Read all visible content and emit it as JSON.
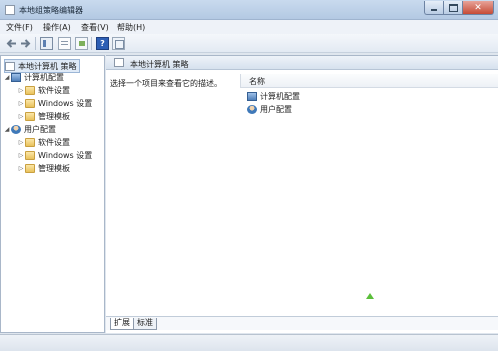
{
  "window": {
    "title": "本地组策略编辑器"
  },
  "menu": [
    "文件(F)",
    "操作(A)",
    "查看(V)",
    "帮助(H)"
  ],
  "toolbar": {
    "buttons": [
      "back-arrow-icon",
      "forward-arrow-icon",
      "show-tree-icon",
      "properties-icon",
      "export-icon",
      "help-icon",
      "view-icon"
    ]
  },
  "tree": {
    "root": "本地计算机 策略",
    "computer": {
      "label": "计算机配置",
      "children": [
        "软件设置",
        "Windows 设置",
        "管理模板"
      ]
    },
    "user": {
      "label": "用户配置",
      "children": [
        "软件设置",
        "Windows 设置",
        "管理模板"
      ]
    }
  },
  "right": {
    "header": "本地计算机 策略",
    "description": "选择一个项目来查看它的描述。",
    "column_name": "名称",
    "items": [
      "计算机配置",
      "用户配置"
    ]
  },
  "tabs": [
    "扩展",
    "标准"
  ],
  "colors": {
    "accent": "#3f79b9",
    "folder": "#e9c25c",
    "selection": "#dfeaf7"
  }
}
